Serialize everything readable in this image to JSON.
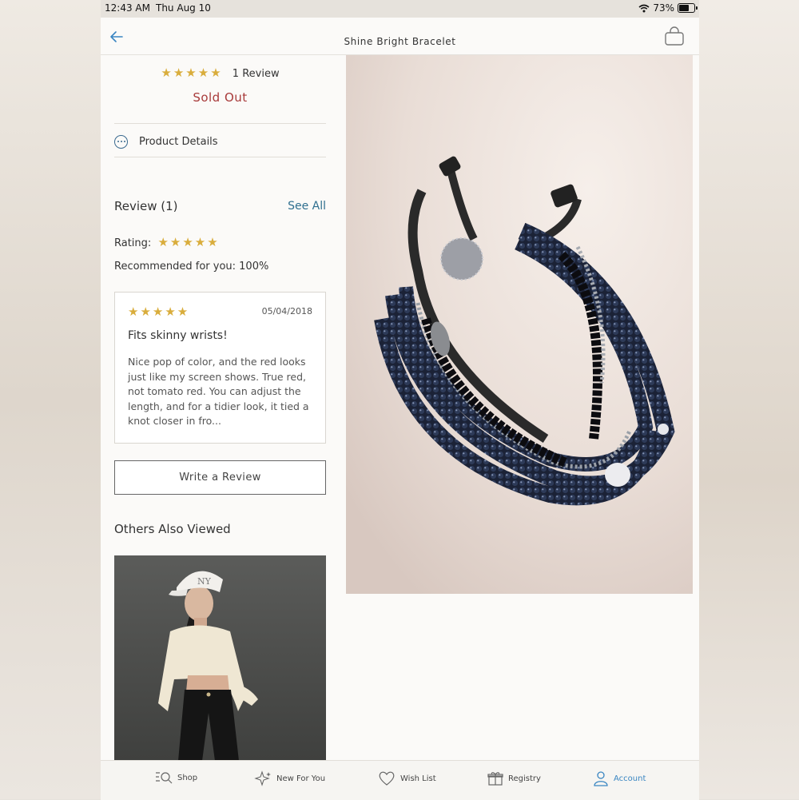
{
  "status": {
    "time": "12:43 AM",
    "date": "Thu Aug 10",
    "battery": "73%"
  },
  "header": {
    "title": "Shine Bright Bracelet",
    "back_icon": "back-arrow-icon",
    "bag_icon": "shopping-bag-icon"
  },
  "summary": {
    "stars": "★★★★★",
    "review_count": "1 Review",
    "availability": "Sold Out"
  },
  "product_details": {
    "label": "Product Details",
    "icon": "more-dots-icon"
  },
  "reviews": {
    "heading": "Review (1)",
    "see_all": "See All",
    "rating_label": "Rating:",
    "rating_stars": "★★★★★",
    "recommend": "Recommended for you: 100%",
    "items": [
      {
        "stars": "★★★★★",
        "date": "05/04/2018",
        "title": "Fits skinny wrists!",
        "body": "Nice pop of color, and the red looks just like my screen shows. True red, not tomato red.  You can adjust the length, and for a tidier look, it tied a knot closer in fro..."
      }
    ],
    "write_button": "Write a Review"
  },
  "others": {
    "heading": "Others Also Viewed"
  },
  "tabs": [
    {
      "label": "Shop",
      "icon": "search-list-icon",
      "active": false
    },
    {
      "label": "New For You",
      "icon": "sparkle-icon",
      "active": false
    },
    {
      "label": "Wish List",
      "icon": "heart-icon",
      "active": false
    },
    {
      "label": "Registry",
      "icon": "gift-icon",
      "active": false
    },
    {
      "label": "Account",
      "icon": "person-icon",
      "active": true
    }
  ],
  "colors": {
    "accent_link": "#2f6f8f",
    "sold_out": "#a83a3a",
    "star": "#d9ad3c",
    "active_tab": "#3a86c2"
  }
}
